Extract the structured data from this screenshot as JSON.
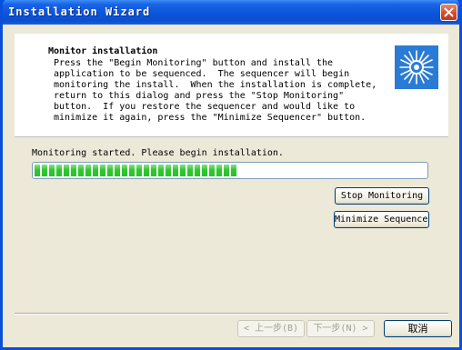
{
  "window": {
    "title": "Installation Wizard"
  },
  "header": {
    "title": "Monitor installation",
    "description": "Press the \"Begin Monitoring\" button and install the\napplication to be sequenced.  The sequencer will begin\nmonitoring the install.  When the installation is complete,\nreturn to this dialog and press the \"Stop Monitoring\"\nbutton.  If you restore the sequencer and would like to\nminimize it again, press the \"Minimize Sequencer\" button."
  },
  "status": {
    "text": "Monitoring started.  Please begin installation."
  },
  "progress": {
    "percent": 52,
    "color": "#2ec92e"
  },
  "buttons": {
    "stop_monitoring": "Stop Monitoring",
    "minimize_sequencer": "Minimize Sequencer",
    "back": "< 上一步(B)",
    "next": "下一步(N) >",
    "cancel": "取消"
  },
  "icons": {
    "close": "close-icon",
    "wizard": "starburst-icon"
  }
}
